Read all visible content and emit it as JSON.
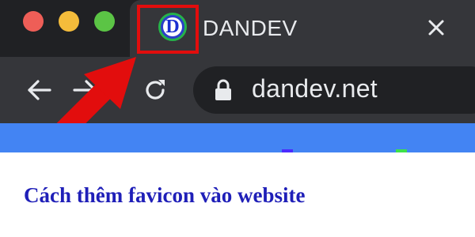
{
  "window": {
    "controls": [
      {
        "name": "close",
        "color": "#ee5e57"
      },
      {
        "name": "minimize",
        "color": "#f4bc3b"
      },
      {
        "name": "maximize",
        "color": "#5bc445"
      }
    ]
  },
  "tab": {
    "title": "DANDEV",
    "favicon_letter": "D",
    "close_icon": "close-icon"
  },
  "toolbar": {
    "back_icon": "arrow-left-icon",
    "forward_icon": "arrow-right-icon",
    "reload_icon": "reload-icon",
    "lock_icon": "lock-icon",
    "url": "dandev.net"
  },
  "annotation": {
    "highlight_color": "#e20d0d",
    "arrow_color": "#e20d0d"
  },
  "page": {
    "banner_color": "#4384f3",
    "headline": "Cách thêm favicon vào website"
  }
}
